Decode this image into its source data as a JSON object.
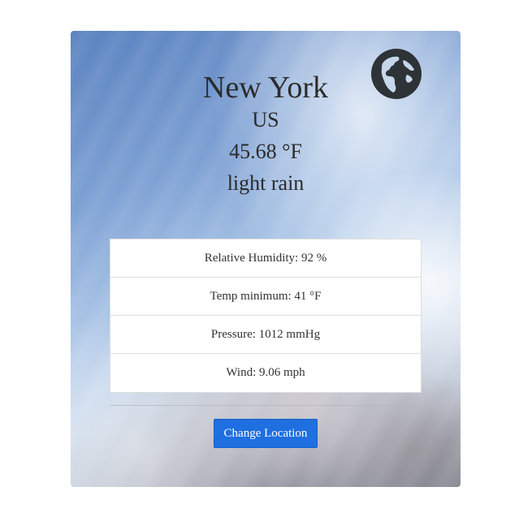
{
  "weather": {
    "city": "New York",
    "country": "US",
    "temperature": "45.68 °F",
    "description": "light rain"
  },
  "details": [
    {
      "text": "Relative Humidity: 92 %"
    },
    {
      "text": "Temp minimum: 41 °F"
    },
    {
      "text": "Pressure: 1012 mmHg"
    },
    {
      "text": "Wind: 9.06 mph"
    }
  ],
  "actions": {
    "change_location_label": "Change Location"
  },
  "icons": {
    "globe": "globe-icon"
  },
  "colors": {
    "button": "#1f6fe0",
    "globe": "#2e3338",
    "text": "#2b2b2b"
  }
}
